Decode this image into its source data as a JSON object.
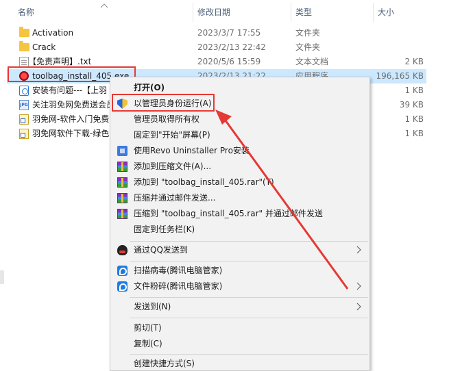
{
  "columns": {
    "name": "名称",
    "date": "修改日期",
    "type": "类型",
    "size": "大小"
  },
  "files": [
    {
      "name": "Activation",
      "date": "2023/3/7 17:55",
      "type": "文件夹",
      "size": "",
      "icon": "folder-icon"
    },
    {
      "name": "Crack",
      "date": "2023/2/13 22:42",
      "type": "文件夹",
      "size": "",
      "icon": "folder-icon"
    },
    {
      "name": "【免责声明】.txt",
      "date": "2020/5/6 15:59",
      "type": "文本文档",
      "size": "2 KB",
      "icon": "text-file-icon"
    },
    {
      "name": "toolbag_install_405.exe",
      "date": "2023/2/13 21:22",
      "type": "应用程序",
      "size": "196,165 KB",
      "icon": "app-icon"
    },
    {
      "name": "安装有问题---【上羽",
      "date": "",
      "type": "",
      "size": "1 KB",
      "icon": "url-icon"
    },
    {
      "name": "关注羽免网免费送会员",
      "date": "",
      "type": "",
      "size": "39 KB",
      "icon": "jpg-icon"
    },
    {
      "name": "羽免网-软件入门免费",
      "date": "",
      "type": "",
      "size": "1 KB",
      "icon": "shortcut-icon"
    },
    {
      "name": "羽免网软件下载-绿色",
      "date": "",
      "type": "",
      "size": "1 KB",
      "icon": "shortcut-icon"
    }
  ],
  "menu": {
    "open": "打开(O)",
    "run_as_admin": "以管理员身份运行(A)",
    "take_ownership": "管理员取得所有权",
    "pin_start": "固定到\"开始\"屏幕(P)",
    "revo": "使用Revo Uninstaller Pro安装",
    "add_archive": "添加到压缩文件(A)...",
    "add_rar": "添加到 \"toolbag_install_405.rar\"(T)",
    "compress_email": "压缩并通过邮件发送...",
    "compress_rar_email": "压缩到 \"toolbag_install_405.rar\" 并通过邮件发送",
    "pin_taskbar": "固定到任务栏(K)",
    "send_qq": "通过QQ发送到",
    "scan_virus": "扫描病毒(腾讯电脑管家)",
    "shred": "文件粉碎(腾讯电脑管家)",
    "send_to": "发送到(N)",
    "cut": "剪切(T)",
    "copy": "复制(C)",
    "create_shortcut": "创建快捷方式(S)"
  },
  "colors": {
    "highlight_red": "#e53935",
    "selection": "#cce8ff",
    "menu_bg": "#f2f2f2"
  }
}
